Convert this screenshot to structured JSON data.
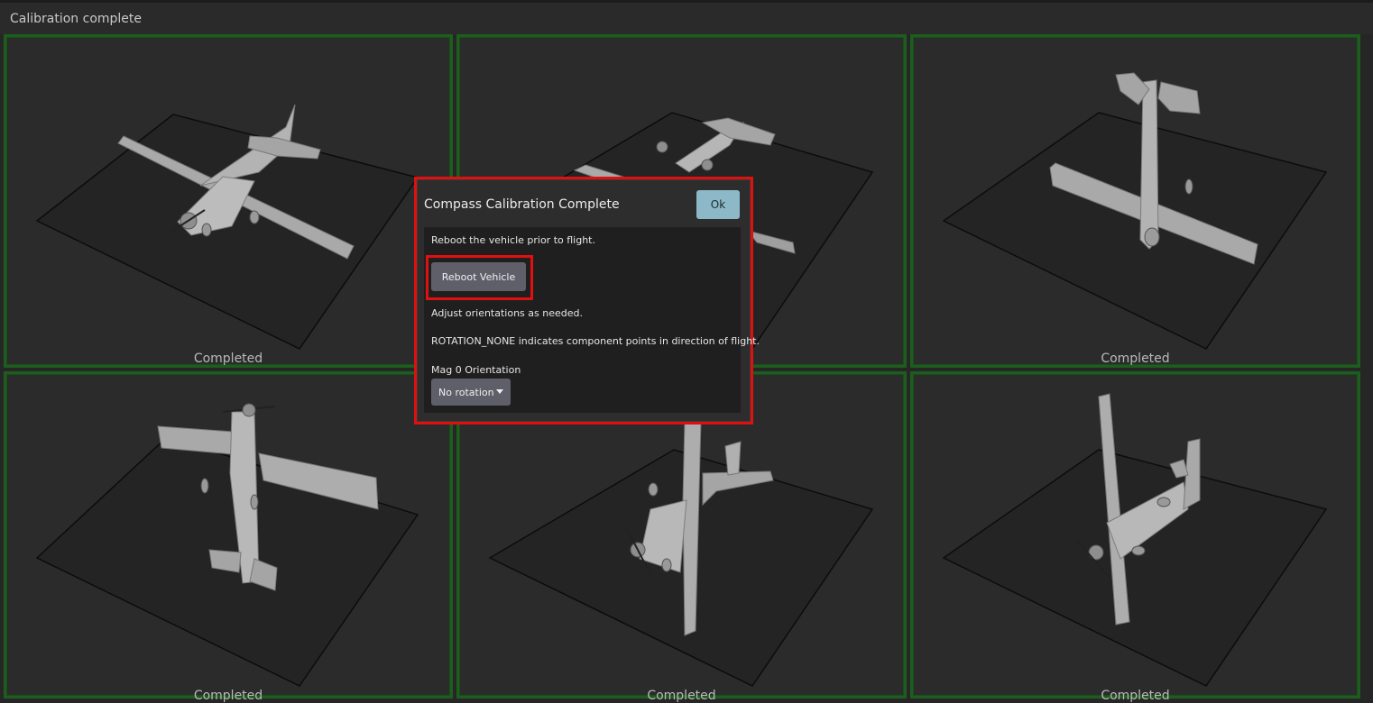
{
  "header": {
    "title": "Calibration complete"
  },
  "tiles": [
    {
      "status": "Completed"
    },
    {
      "status": "Completed"
    },
    {
      "status": "Completed"
    },
    {
      "status": "Completed"
    },
    {
      "status": "Completed"
    },
    {
      "status": "Completed"
    }
  ],
  "dialog": {
    "title": "Compass Calibration Complete",
    "ok_label": "Ok",
    "reboot_text": "Reboot the vehicle prior to flight.",
    "reboot_button": "Reboot Vehicle",
    "adjust_text": "Adjust orientations as needed.",
    "rotation_text": "ROTATION_NONE indicates component points in direction of flight.",
    "mag_label": "Mag 0 Orientation",
    "mag_value": "No rotation"
  },
  "colors": {
    "tile_border": "#1f5c1f",
    "highlight": "#e01010",
    "ok_button": "#8cb8c8"
  }
}
